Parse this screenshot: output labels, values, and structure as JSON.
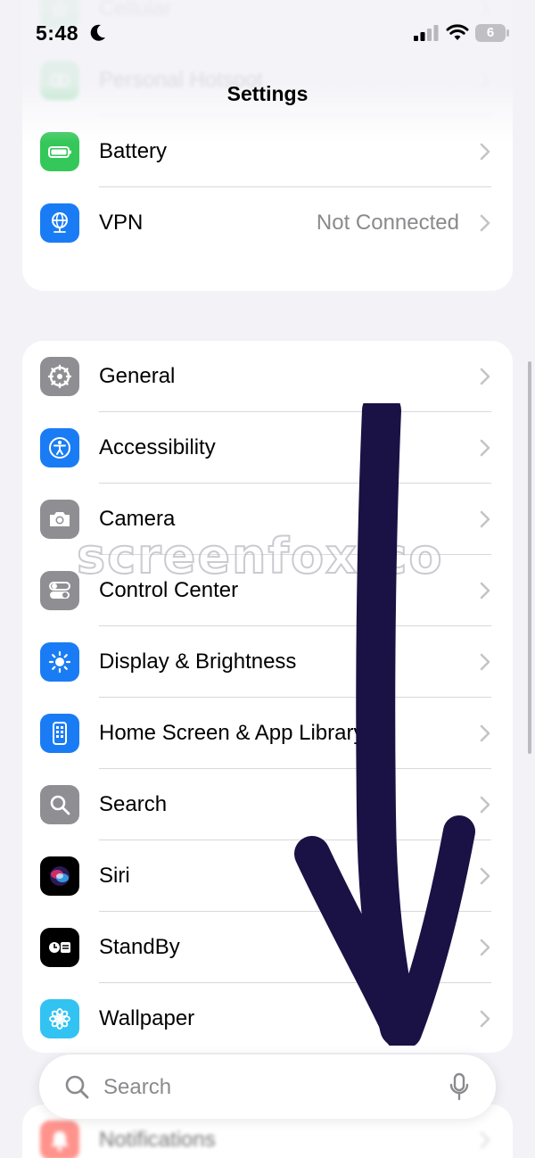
{
  "status": {
    "time": "5:48",
    "battery_level": "6"
  },
  "nav": {
    "title": "Settings"
  },
  "group_top": [
    {
      "label": "Cellular",
      "value": "",
      "icon": "cellular-icon",
      "color": "#34c759"
    },
    {
      "label": "Personal Hotspot",
      "value": "",
      "icon": "hotspot-icon",
      "color": "#34c759"
    },
    {
      "label": "Battery",
      "value": "",
      "icon": "battery-icon",
      "color": "#34c759"
    },
    {
      "label": "VPN",
      "value": "Not Connected",
      "icon": "vpn-globe-icon",
      "color": "#1a7cf5"
    }
  ],
  "group_mid": [
    {
      "label": "General",
      "icon": "gear-icon",
      "color": "#8e8e93"
    },
    {
      "label": "Accessibility",
      "icon": "accessibility-icon",
      "color": "#1a7cf5"
    },
    {
      "label": "Camera",
      "icon": "camera-icon",
      "color": "#8e8e93"
    },
    {
      "label": "Control Center",
      "icon": "toggles-icon",
      "color": "#8e8e93"
    },
    {
      "label": "Display & Brightness",
      "icon": "sun-icon",
      "color": "#1a7cf5"
    },
    {
      "label": "Home Screen & App Library",
      "icon": "phone-grid-icon",
      "color": "#1a7cf5"
    },
    {
      "label": "Search",
      "icon": "search-icon",
      "color": "#8e8e93"
    },
    {
      "label": "Siri",
      "icon": "siri-icon",
      "color": "#000000"
    },
    {
      "label": "StandBy",
      "icon": "standby-icon",
      "color": "#000000"
    },
    {
      "label": "Wallpaper",
      "icon": "flower-icon",
      "color": "#32c3f2"
    }
  ],
  "group_bottom": [
    {
      "label": "Notifications",
      "icon": "bell-icon",
      "color": "#ff3b30"
    }
  ],
  "search": {
    "placeholder": "Search"
  },
  "watermark": "screenfox.co"
}
